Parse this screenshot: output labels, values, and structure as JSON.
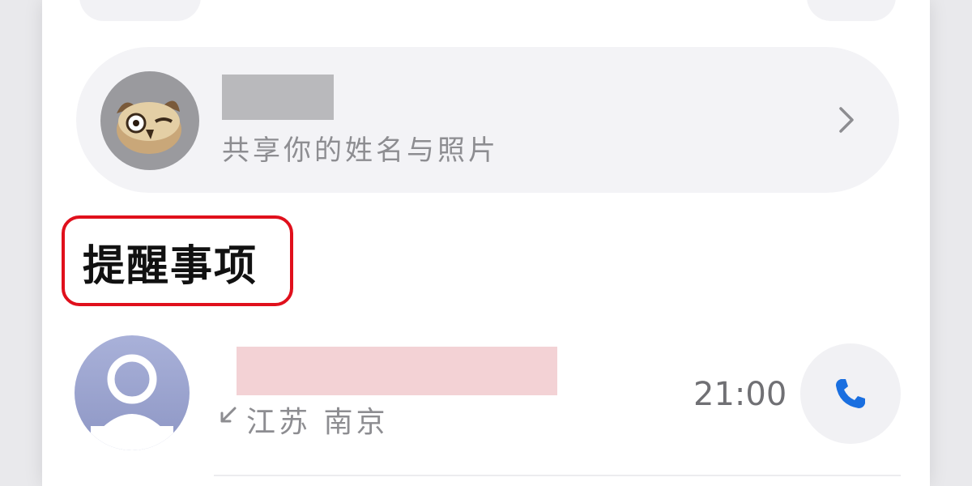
{
  "profile": {
    "subtitle": "共享你的姓名与照片",
    "avatar_icon": "owl-avatar-icon",
    "chevron_icon": "chevron-right-icon"
  },
  "section": {
    "title": "提醒事项",
    "highlight_color": "#e0101c"
  },
  "recent_call": {
    "location": "江苏 南京",
    "time": "21:00",
    "direction_icon": "incoming-call-arrow-icon",
    "action_icon": "phone-icon",
    "accent_color": "#1a6fe0"
  }
}
